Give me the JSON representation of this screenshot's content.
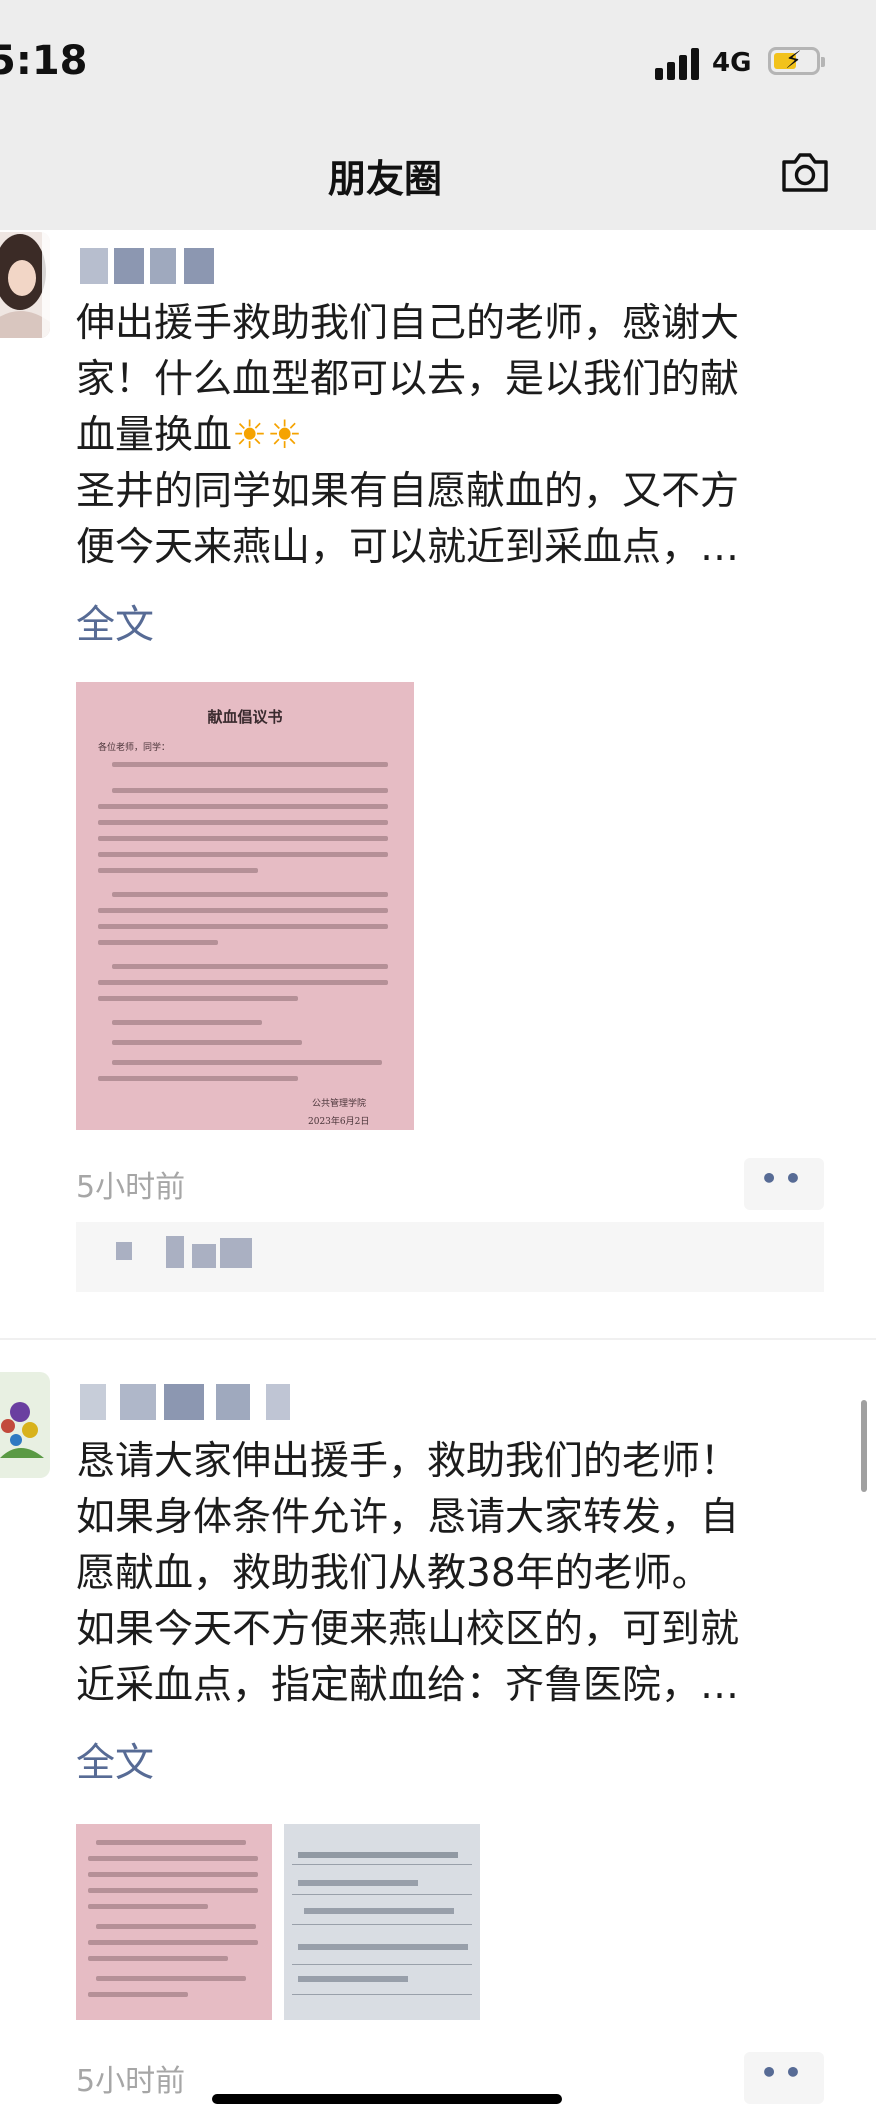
{
  "status_bar": {
    "time": "5:18",
    "network": "4G"
  },
  "nav": {
    "title": "朋友圈"
  },
  "colors": {
    "link": "#576b95",
    "doc_pink": "#e6bcc4",
    "nav_bg": "#ededed"
  },
  "posts": [
    {
      "body_lines": [
        "伸出援手救助我们自己的老师，感谢大",
        "家！什么血型都可以去，是以我们的献",
        "血量换血",
        "圣井的同学如果有自愿献血的，又不方",
        "便今天来燕山，可以就近到采血点，…"
      ],
      "full_text_link": "全文",
      "time": "5小时前",
      "attachment": {
        "title": "献血倡议书",
        "salutation": "各位老师，同学：",
        "footer_org": "公共管理学院",
        "footer_date": "2023年6月2日"
      }
    },
    {
      "body_lines": [
        "恳请大家伸出援手，救助我们的老师！",
        "如果身体条件允许，恳请大家转发，自",
        "愿献血，救助我们从教38年的老师。",
        "如果今天不方便来燕山校区的，可到就",
        "近采血点，指定献血给：齐鲁医院，…"
      ],
      "full_text_link": "全文",
      "time": "5小时前"
    }
  ]
}
